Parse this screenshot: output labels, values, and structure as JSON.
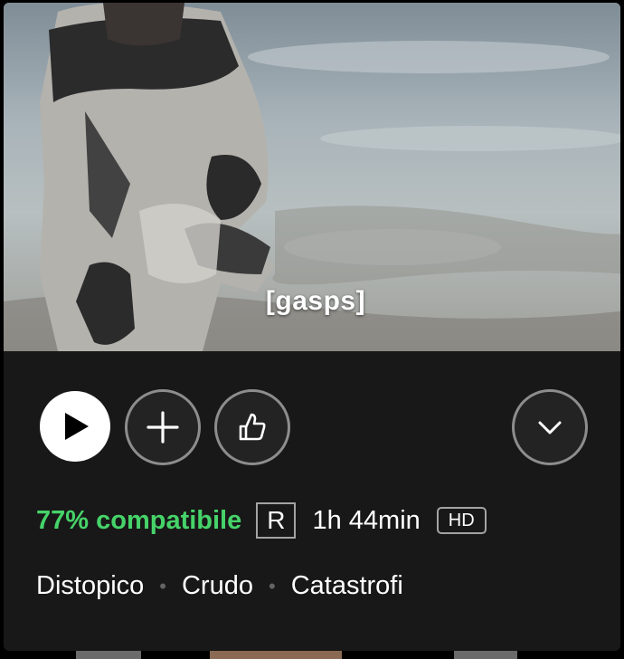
{
  "video": {
    "subtitle_text": "[gasps]"
  },
  "actions": {
    "play_icon": "play-icon",
    "add_icon": "plus-icon",
    "like_icon": "thumbs-up-icon",
    "more_icon": "chevron-down-icon"
  },
  "meta": {
    "match": "77% compatibile",
    "rating": "R",
    "duration": "1h 44min",
    "quality": "HD"
  },
  "tags": [
    "Distopico",
    "Crudo",
    "Catastrofi"
  ],
  "colors": {
    "match_green": "#46d369",
    "card_background": "#181818",
    "button_border": "#8d8d8d"
  }
}
